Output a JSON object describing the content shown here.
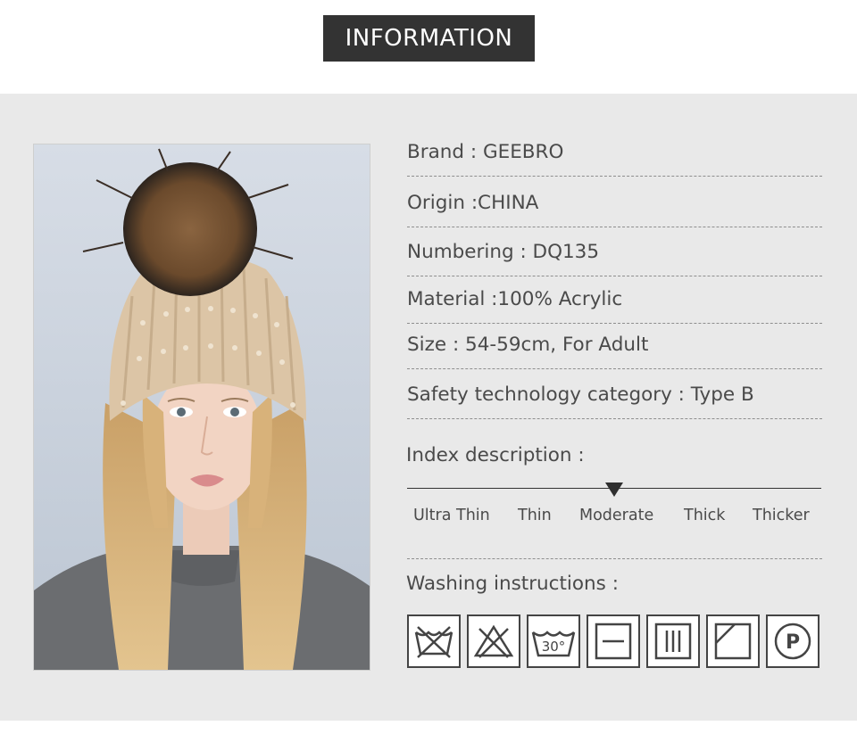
{
  "header": {
    "title": "INFORMATION"
  },
  "photo": {
    "subject": "woman-wearing-pearl-knit-beanie-with-fur-pompom"
  },
  "specs": [
    {
      "text": "Brand : GEEBRO"
    },
    {
      "text": "Origin :CHINA"
    },
    {
      "text": "Numbering : DQ135"
    },
    {
      "text": "Material :100% Acrylic"
    },
    {
      "text": "Size : 54-59cm, For Adult"
    },
    {
      "text": "Safety technology category : Type B"
    }
  ],
  "index": {
    "title": "Index description :",
    "labels": [
      "Ultra Thin",
      "Thin",
      "Moderate",
      "Thick",
      "Thicker"
    ],
    "selected": "Moderate"
  },
  "washing": {
    "title": "Washing instructions :",
    "temperature": "30°",
    "icons": [
      "no-wash-icon",
      "no-bleach-icon",
      "wash-30-icon",
      "dry-flat-icon",
      "drip-dry-icon",
      "dry-in-shade-icon",
      "professional-dry-clean-icon"
    ]
  },
  "colors": {
    "badge_bg": "#333333",
    "panel_bg": "#e9e9e9",
    "text": "#4a4a4a"
  }
}
